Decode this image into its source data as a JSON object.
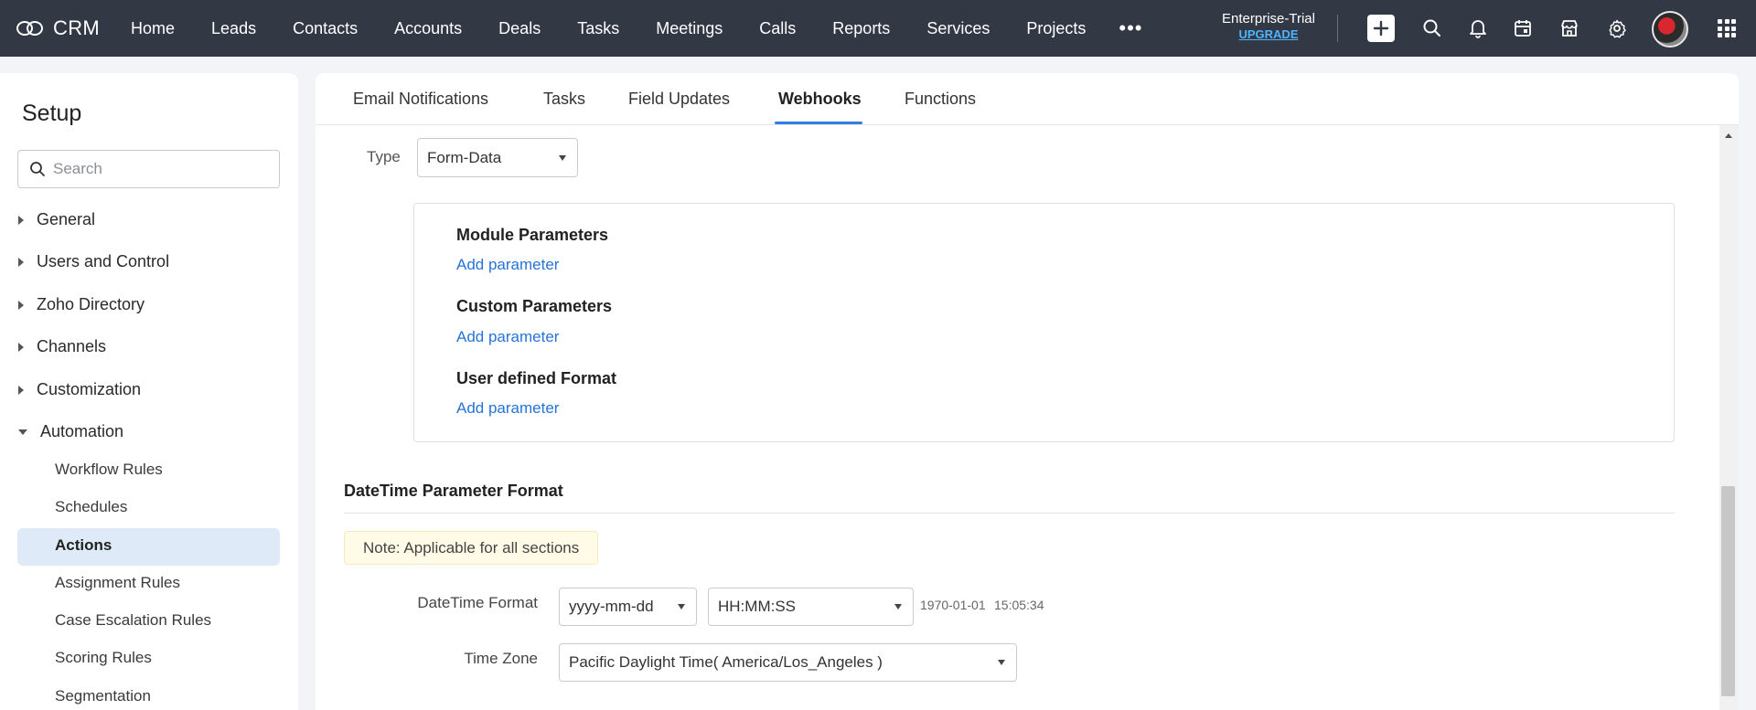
{
  "app": {
    "name": "CRM"
  },
  "nav": {
    "items": [
      "Home",
      "Leads",
      "Contacts",
      "Accounts",
      "Deals",
      "Tasks",
      "Meetings",
      "Calls",
      "Reports",
      "Services",
      "Projects"
    ],
    "more": "•••"
  },
  "account": {
    "edition": "Enterprise-Trial",
    "upgrade": "UPGRADE"
  },
  "sidebar": {
    "title": "Setup",
    "search_placeholder": "Search",
    "sections": [
      "General",
      "Users and Control",
      "Zoho Directory",
      "Channels",
      "Customization",
      "Automation"
    ],
    "automation_items": [
      "Workflow Rules",
      "Schedules",
      "Actions",
      "Assignment Rules",
      "Case Escalation Rules",
      "Scoring Rules",
      "Segmentation"
    ],
    "active_item": "Actions"
  },
  "tabs": [
    "Email Notifications",
    "Tasks",
    "Field Updates",
    "Webhooks",
    "Functions"
  ],
  "active_tab": "Webhooks",
  "form": {
    "type_label": "Type",
    "type_value": "Form-Data",
    "params": [
      {
        "heading": "Module Parameters",
        "link": "Add parameter"
      },
      {
        "heading": "Custom Parameters",
        "link": "Add parameter"
      },
      {
        "heading": "User defined Format",
        "link": "Add parameter"
      }
    ],
    "datetime": {
      "title": "DateTime Parameter Format",
      "note": "Note: Applicable for all sections",
      "format_label": "DateTime Format",
      "date_format": "yyyy-mm-dd",
      "time_format": "HH:MM:SS",
      "preview_date": "1970-01-01",
      "preview_time": "15:05:34",
      "timezone_label": "Time Zone",
      "timezone": "Pacific Daylight Time( America/Los_Angeles )"
    }
  },
  "colors": {
    "topbar": "#333845",
    "accent": "#2f7fe0",
    "link": "#2673d9",
    "active_bg": "#deeaf8"
  }
}
